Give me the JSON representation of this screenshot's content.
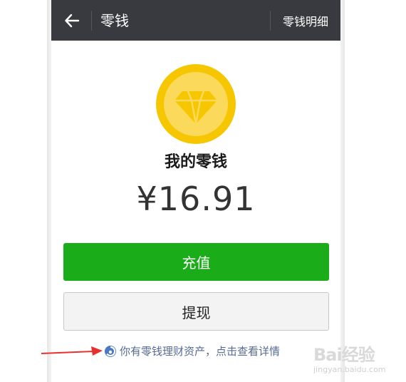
{
  "titlebar": {
    "title": "零钱",
    "detail_link": "零钱明细",
    "back_icon": "arrow-left-icon"
  },
  "wallet": {
    "icon": "diamond-coin-icon",
    "label": "我的零钱",
    "balance": "¥16.91"
  },
  "actions": {
    "topup_label": "充值",
    "withdraw_label": "提现"
  },
  "wealth_link": {
    "icon": "wealth-icon",
    "text": "你有零钱理财资产，点击查看详情"
  },
  "watermark": {
    "text": "Bai经验",
    "sub": "jingyan.baidu.com"
  },
  "colors": {
    "titlebar_bg": "#393a3f",
    "accent_green": "#1aad19",
    "link_blue": "#576b95",
    "coin_gold": "#f6c700",
    "annotation_red": "#e8312f"
  }
}
